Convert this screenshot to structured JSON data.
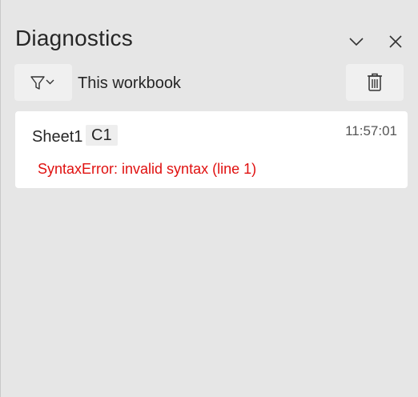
{
  "pane": {
    "title": "Diagnostics",
    "icons": {
      "collapse": "chevron-down-icon",
      "close": "close-icon",
      "filter": "filter-icon",
      "delete": "trash-icon"
    }
  },
  "toolbar": {
    "scope_label": "This workbook"
  },
  "entries": [
    {
      "sheet": "Sheet1",
      "cell": "C1",
      "time": "11:57:01",
      "message": "SyntaxError: invalid syntax (line 1)"
    }
  ],
  "colors": {
    "background": "#e6e6e6",
    "card": "#ffffff",
    "error": "#e0100f",
    "button": "#f0f0f0"
  }
}
